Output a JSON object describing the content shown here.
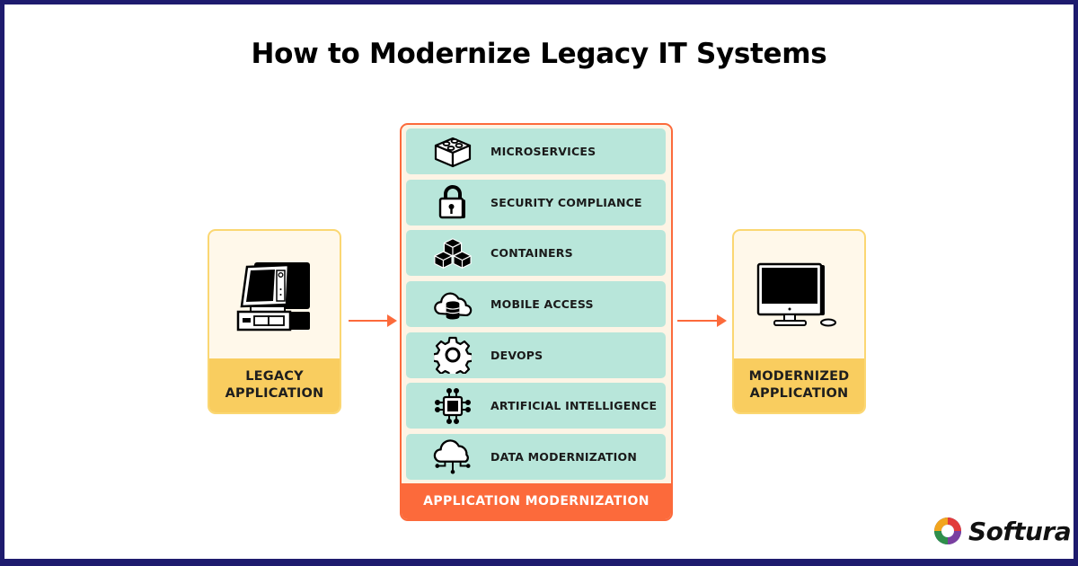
{
  "title": "How to Modernize Legacy IT Systems",
  "legacy_card": {
    "icon": "legacy-computer-icon",
    "line1": "LEGACY",
    "line2": "APPLICATION"
  },
  "modern_card": {
    "icon": "modern-desktop-icon",
    "line1": "MODERNIZED",
    "line2": "APPLICATION"
  },
  "modernization_panel": {
    "footer_label": "APPLICATION MODERNIZATION",
    "items": [
      {
        "label": "MICROSERVICES",
        "icon": "building-block-icon"
      },
      {
        "label": "SECURITY COMPLIANCE",
        "icon": "padlock-icon"
      },
      {
        "label": "CONTAINERS",
        "icon": "stacked-cubes-icon"
      },
      {
        "label": "MOBILE ACCESS",
        "icon": "cloud-database-icon"
      },
      {
        "label": "DEVOPS",
        "icon": "gear-icon"
      },
      {
        "label": "ARTIFICIAL INTELLIGENCE",
        "icon": "chip-icon"
      },
      {
        "label": "DATA MODERNIZATION",
        "icon": "cloud-network-icon"
      }
    ]
  },
  "brand": {
    "name": "Softura"
  },
  "colors": {
    "frame": "#1e1b6e",
    "accent_orange": "#fc6a3b",
    "row_teal": "#b8e6da",
    "card_yellow": "#f9cd5f",
    "card_cream": "#fff8ea"
  }
}
